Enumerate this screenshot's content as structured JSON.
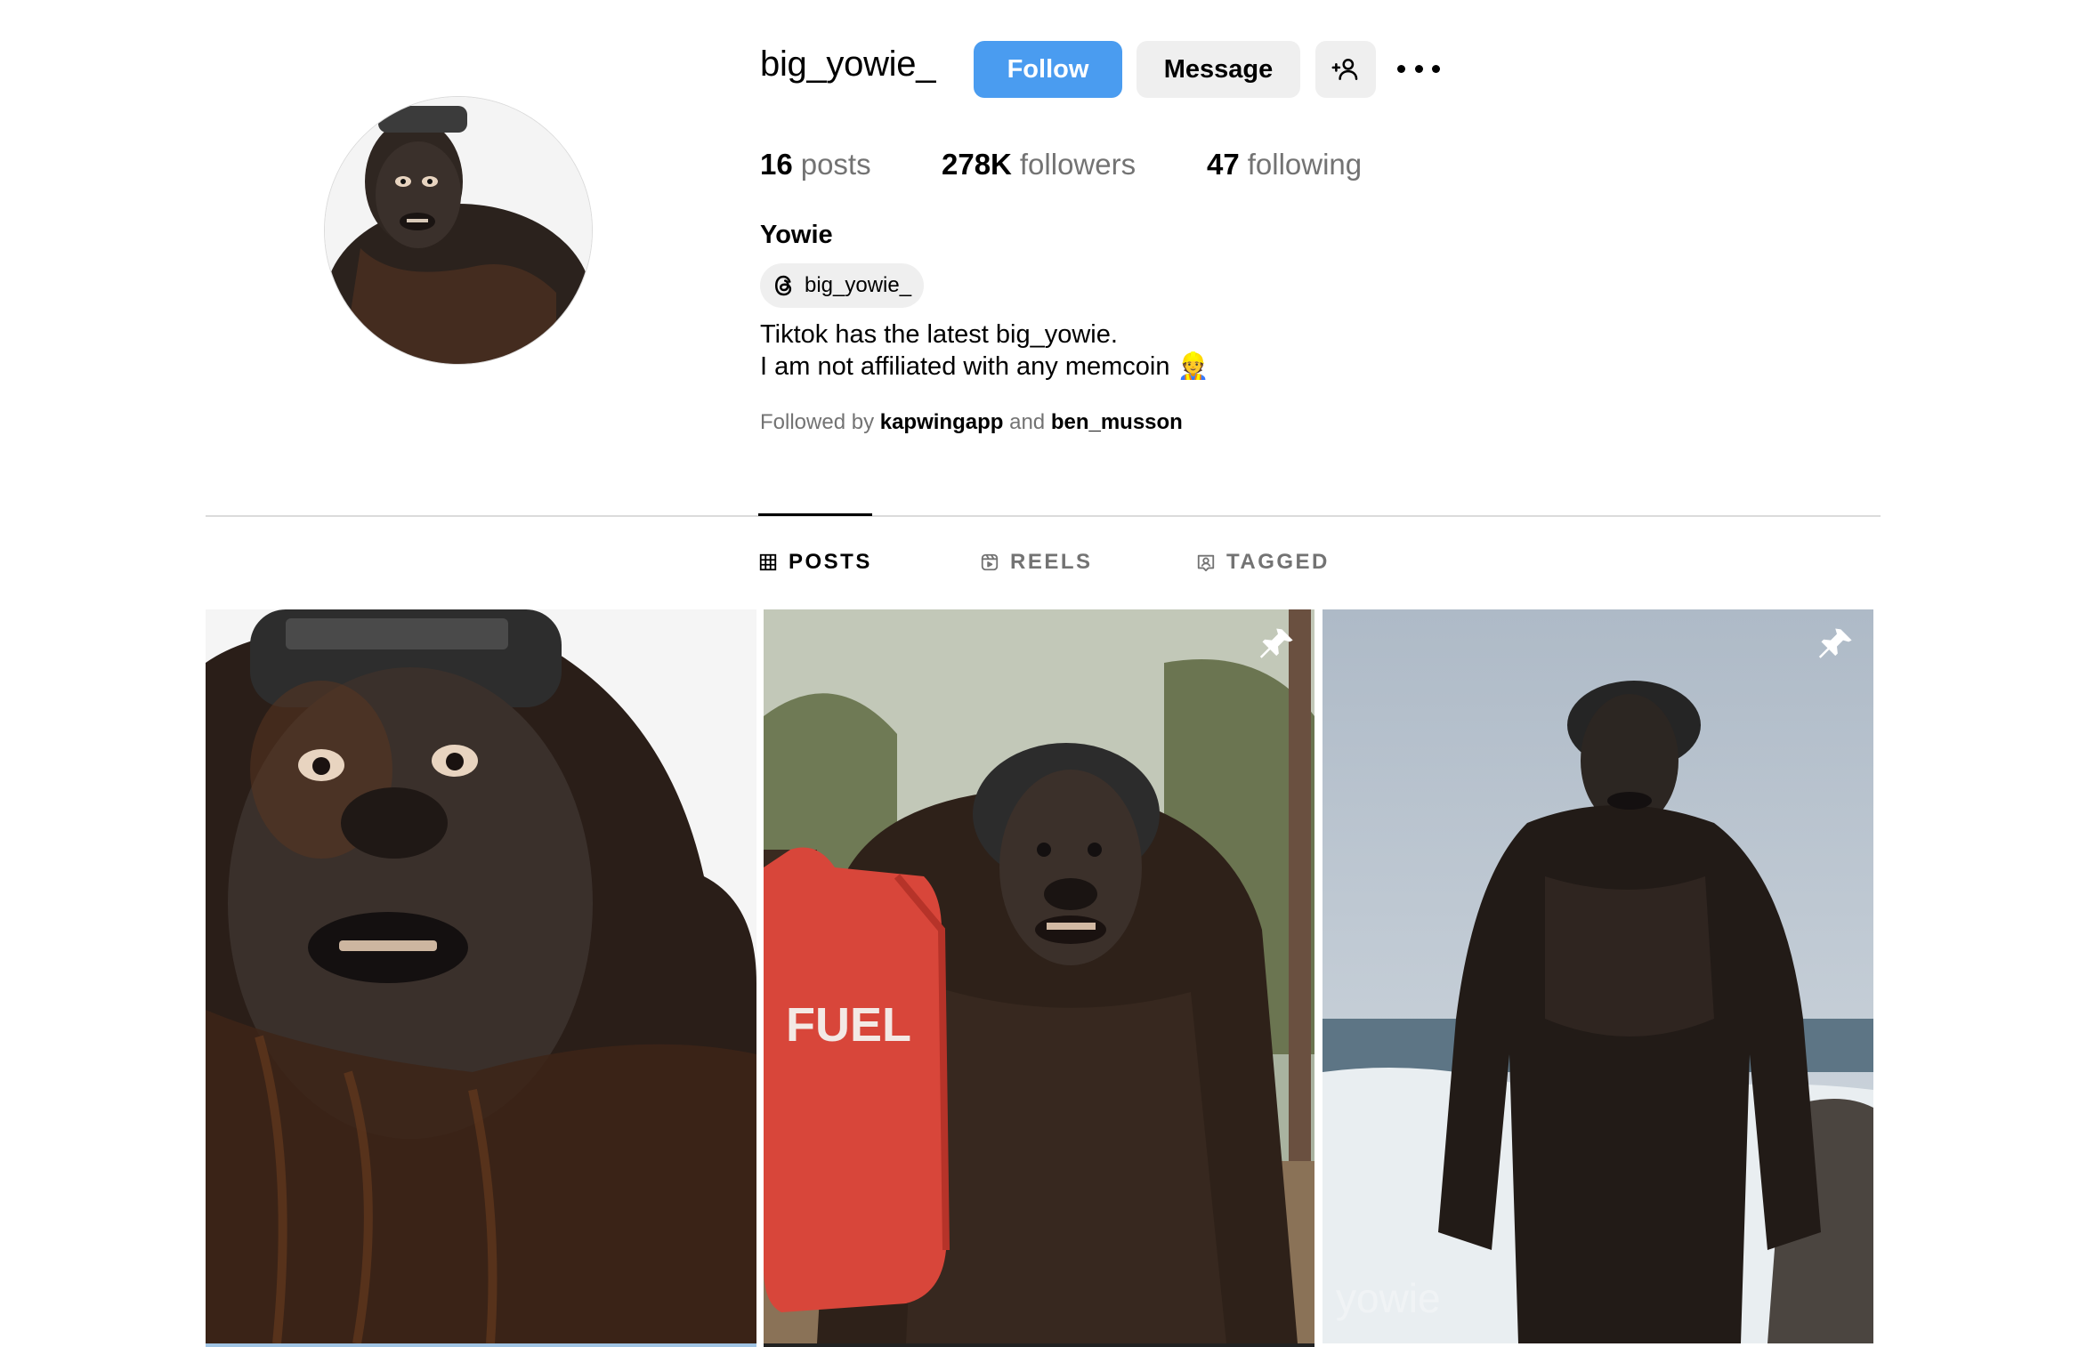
{
  "profile": {
    "username": "big_yowie_",
    "follow_label": "Follow",
    "message_label": "Message",
    "add_user_icon": "person-plus-icon",
    "more_icon": "ellipsis-icon",
    "avatar_alt": "profile picture"
  },
  "stats": {
    "posts_count": "16",
    "posts_label": "posts",
    "followers_count": "278K",
    "followers_label": "followers",
    "following_count": "47",
    "following_label": "following"
  },
  "bio": {
    "full_name": "Yowie",
    "threads_handle": "big_yowie_",
    "line1": "Tiktok has the latest big_yowie.",
    "line2": "I am not affiliated with any memcoin 👷",
    "followed_by_prefix": "Followed by",
    "followed_by_user1": "kapwingapp",
    "followed_by_and": "and",
    "followed_by_user2": "ben_musson"
  },
  "tabs": [
    {
      "label": "POSTS",
      "icon": "grid-icon",
      "active": true
    },
    {
      "label": "REELS",
      "icon": "reels-icon",
      "active": false
    },
    {
      "label": "TAGGED",
      "icon": "tagged-icon",
      "active": false
    }
  ],
  "posts": [
    {
      "pinned": false,
      "caption_text": ""
    },
    {
      "pinned": true,
      "caption_text": "FUEL"
    },
    {
      "pinned": true,
      "caption_text": "yowie"
    }
  ],
  "colors": {
    "follow_button": "#4a9cf0",
    "secondary_button": "#efefef",
    "muted_text": "#737373",
    "divider": "#dbdbdb"
  }
}
